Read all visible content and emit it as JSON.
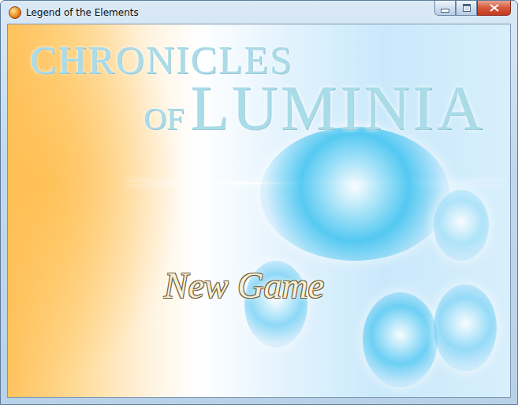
{
  "window": {
    "title": "Legend of the Elements"
  },
  "logo": {
    "top": "CHRONICLES",
    "prefix": "OF",
    "main": "LUMINIA"
  },
  "menu": [
    {
      "label": "New Game"
    }
  ]
}
